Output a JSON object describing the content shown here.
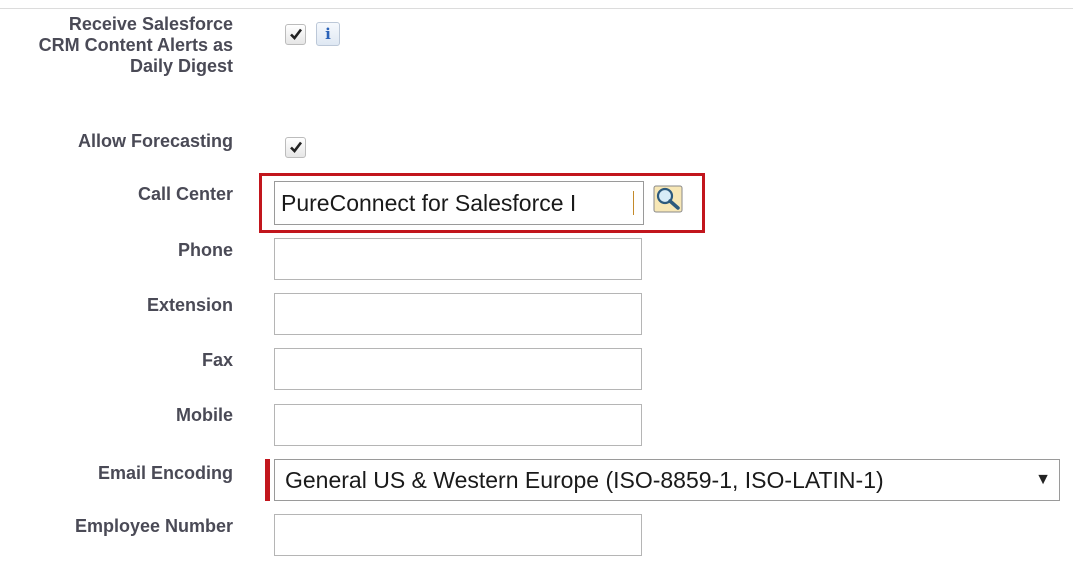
{
  "form": {
    "content_alerts": {
      "label": "Receive Salesforce CRM Content Alerts as Daily Digest",
      "checked": true,
      "info_label": "i"
    },
    "forecasting": {
      "label": "Allow Forecasting",
      "checked": true
    },
    "call_center": {
      "label": "Call Center",
      "value": "PureConnect for Salesforce I",
      "lookup_icon": "magnifier-lookup-icon"
    },
    "phone": {
      "label": "Phone",
      "value": ""
    },
    "extension": {
      "label": "Extension",
      "value": ""
    },
    "fax": {
      "label": "Fax",
      "value": ""
    },
    "mobile": {
      "label": "Mobile",
      "value": ""
    },
    "email_encoding": {
      "label": "Email Encoding",
      "selected": "General US & Western Europe (ISO-8859-1, ISO-LATIN-1)",
      "arrow": "▼"
    },
    "employee_number": {
      "label": "Employee Number",
      "value": ""
    }
  },
  "colors": {
    "highlight": "#c2161d",
    "required": "#c2161d",
    "info_text": "#2a62b8"
  }
}
